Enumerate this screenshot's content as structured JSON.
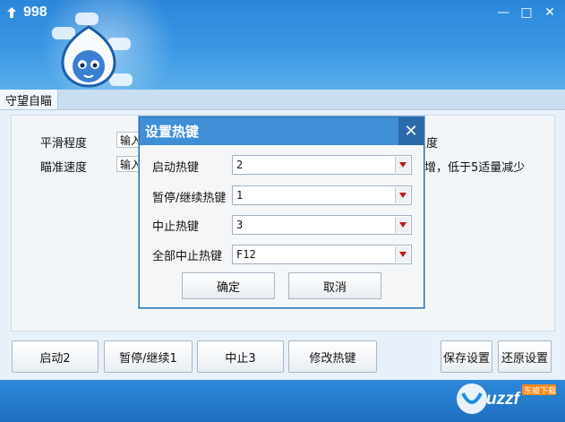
{
  "app": {
    "title": "998"
  },
  "window_controls": {
    "minimize": "—",
    "maximize": "□",
    "close": "✕"
  },
  "tab": {
    "label": "守望自瞄"
  },
  "panel": {
    "rows": [
      {
        "label": "平滑程度",
        "value": "输入",
        "tail": "度"
      },
      {
        "label": "瞄准速度",
        "value": "输入",
        "tail": "增，低于5适量减少"
      }
    ]
  },
  "buttons": {
    "start": "启动2",
    "pause": "暂停/继续1",
    "stop": "中止3",
    "edit_hotkey": "修改热键",
    "save": "保存设置",
    "restore": "还原设置"
  },
  "dialog": {
    "title": "设置热键",
    "close": "✕",
    "fields": [
      {
        "label": "启动热键",
        "value": "2"
      },
      {
        "label": "暂停/继续热键",
        "value": "1"
      },
      {
        "label": "中止热键",
        "value": "3"
      },
      {
        "label": "全部中止热键",
        "value": "F12"
      }
    ],
    "ok": "确定",
    "cancel": "取消"
  },
  "watermark": {
    "brand": "uzzf",
    "sub": "东坡下载"
  },
  "colors": {
    "banner": "#3b98e4",
    "footer": "#2c88da",
    "dialog_title": "#3f8fd6",
    "arrow": "#c01818"
  }
}
